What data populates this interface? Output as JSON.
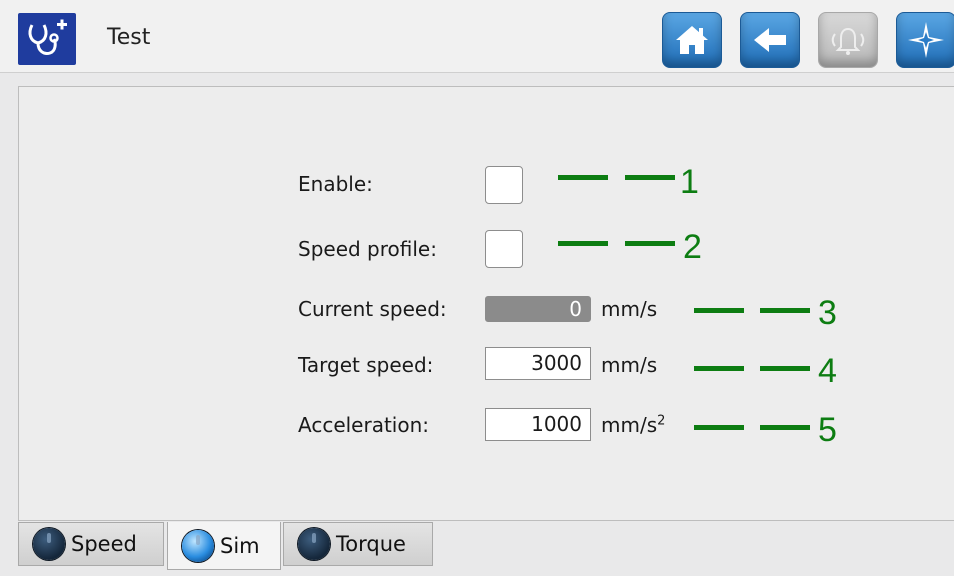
{
  "header": {
    "title": "Test",
    "app_icon": "stethoscope-plus-icon",
    "buttons": [
      {
        "name": "home",
        "icon": "home-icon",
        "enabled": true
      },
      {
        "name": "back",
        "icon": "back-arrow-icon",
        "enabled": true
      },
      {
        "name": "alarm",
        "icon": "bell-icon",
        "enabled": false
      },
      {
        "name": "navigate",
        "icon": "compass-icon",
        "enabled": true
      }
    ]
  },
  "form": {
    "enable": {
      "label": "Enable:",
      "checked": false
    },
    "speed_profile": {
      "label": "Speed profile:",
      "checked": false
    },
    "current_speed": {
      "label": "Current speed:",
      "value": "0",
      "unit": "mm/s"
    },
    "target_speed": {
      "label": "Target speed:",
      "value": "3000",
      "unit": "mm/s"
    },
    "acceleration": {
      "label": "Acceleration:",
      "value": "1000",
      "unit": "mm/s",
      "unit_sup": "2"
    }
  },
  "callouts": [
    "1",
    "2",
    "3",
    "4",
    "5"
  ],
  "tabs": [
    {
      "label": "Speed",
      "active": false
    },
    {
      "label": "Sim",
      "active": true
    },
    {
      "label": "Torque",
      "active": false
    }
  ],
  "colors": {
    "accent_blue": "#2a7cc7",
    "callout_green": "#0d7d12",
    "readonly_field": "#8b8b8b",
    "app_icon_bg": "#1f3c9e"
  }
}
